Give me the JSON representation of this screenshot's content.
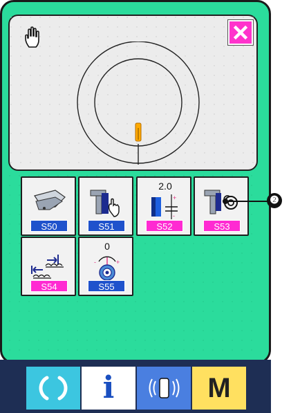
{
  "window": {
    "close_icon": "close-x-icon"
  },
  "screen": {
    "hand_icon": "hand-icon",
    "diagram": "stitch-circle-diagram"
  },
  "buttons": [
    {
      "code": "S50",
      "value": "",
      "icon": "presser-foot-icon",
      "tag_color": "#1f52cc"
    },
    {
      "code": "S51",
      "value": "",
      "icon": "thread-hand-icon",
      "tag_color": "#1f52cc"
    },
    {
      "code": "S52",
      "value": "2.0",
      "icon": "stitch-pitch-icon",
      "tag_color": "#ff2ad2"
    },
    {
      "code": "S53",
      "value": "",
      "icon": "thread-tension-icon",
      "tag_color": "#ff2ad2"
    },
    {
      "code": "S54",
      "value": "",
      "icon": "stitch-shift-icon",
      "tag_color": "#ff2ad2"
    },
    {
      "code": "S55",
      "value": "0",
      "icon": "rotation-angle-icon",
      "tag_color": "#1f52cc"
    }
  ],
  "callout": {
    "label": "❷"
  },
  "bottom": {
    "ready_icon": "ready-cycle-icon",
    "info_label": "i",
    "comm_icon": "communication-icon",
    "mode_label": "M"
  }
}
